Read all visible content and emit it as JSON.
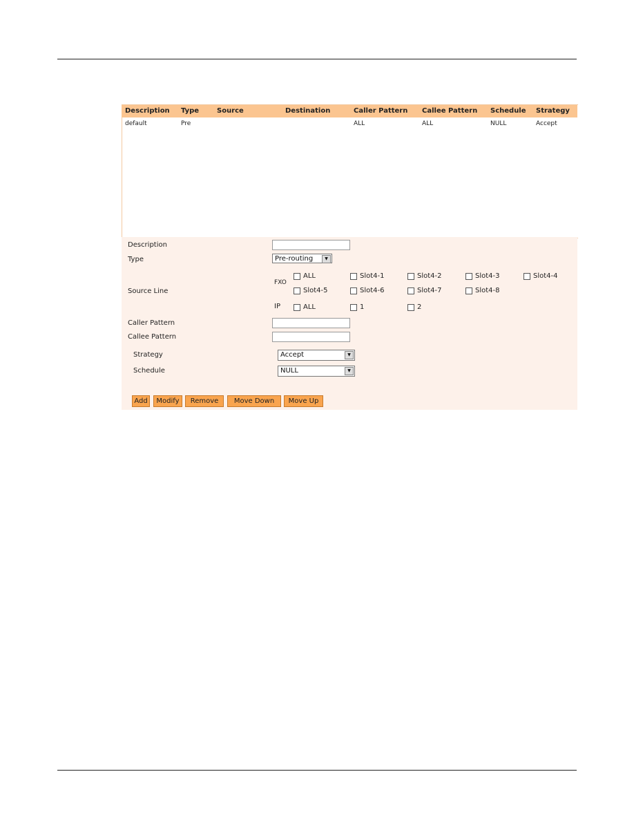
{
  "table": {
    "headers": [
      "Description",
      "Type",
      "Source",
      "Destination",
      "Caller Pattern",
      "Callee Pattern",
      "Schedule",
      "Strategy"
    ],
    "rows": [
      [
        "default",
        "Pre",
        "",
        "",
        "ALL",
        "ALL",
        "NULL",
        "Accept"
      ]
    ]
  },
  "form": {
    "description_label": "Description",
    "description_value": "",
    "type_label": "Type",
    "type_value": "Pre-routing",
    "source_line_label": "Source Line",
    "fxo_label": "FXO",
    "ip_label": "IP",
    "fxo_options": [
      "ALL",
      "Slot4-1",
      "Slot4-2",
      "Slot4-3",
      "Slot4-4",
      "Slot4-5",
      "Slot4-6",
      "Slot4-7",
      "Slot4-8"
    ],
    "ip_options": [
      "ALL",
      "1",
      "2"
    ],
    "caller_label": "Caller Pattern",
    "caller_value": "",
    "callee_label": "Callee Pattern",
    "callee_value": "",
    "strategy_label": "Strategy",
    "strategy_value": "Accept",
    "schedule_label": "Schedule",
    "schedule_value": "NULL"
  },
  "buttons": {
    "add": "Add",
    "modify": "Modify",
    "remove": "Remove",
    "move_down": "Move Down",
    "move_up": "Move Up"
  },
  "colors": {
    "header": "#fbc590",
    "form_bg": "#fdf1ea",
    "button": "#f9a44e"
  }
}
